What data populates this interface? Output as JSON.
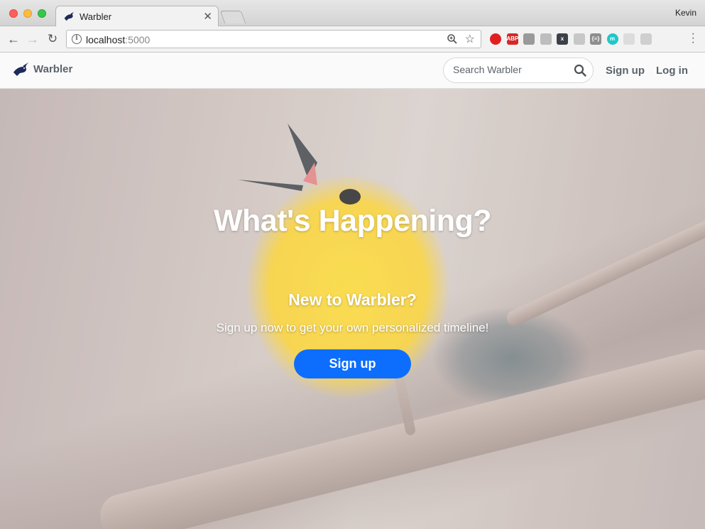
{
  "browser": {
    "tab_title": "Warbler",
    "profile_name": "Kevin",
    "url_host": "localhost",
    "url_port": ":5000",
    "extensions": [
      {
        "name": "opera-icon",
        "label": "",
        "color": "#e02020"
      },
      {
        "name": "adblock-plus-icon",
        "label": "ABP",
        "color": "#d62828"
      },
      {
        "name": "cube-icon",
        "label": "",
        "color": "#9a9a9a"
      },
      {
        "name": "user-agent-icon",
        "label": "",
        "color": "#bdbdbd"
      },
      {
        "name": "x-extension-icon",
        "label": "x",
        "color": "#3c4148"
      },
      {
        "name": "grid-extension-icon",
        "label": "",
        "color": "#c7c7c7"
      },
      {
        "name": "json-viewer-icon",
        "label": "{≡}",
        "color": "#8d8d8d"
      },
      {
        "name": "teal-extension-icon",
        "label": "m",
        "color": "#1fc8c8"
      },
      {
        "name": "wifi-extension-icon",
        "label": "",
        "color": "#dcdcdc"
      },
      {
        "name": "square-extension-icon",
        "label": "",
        "color": "#cfcfcf"
      }
    ]
  },
  "nav": {
    "brand": "Warbler",
    "search_placeholder": "Search Warbler",
    "signup_label": "Sign up",
    "login_label": "Log in"
  },
  "hero": {
    "headline": "What's Happening?",
    "subhead": "New to Warbler?",
    "tagline": "Sign up now to get your own personalized timeline!",
    "cta_label": "Sign up"
  },
  "colors": {
    "accent": "#0d6efd",
    "nav_text": "#5a636c"
  }
}
